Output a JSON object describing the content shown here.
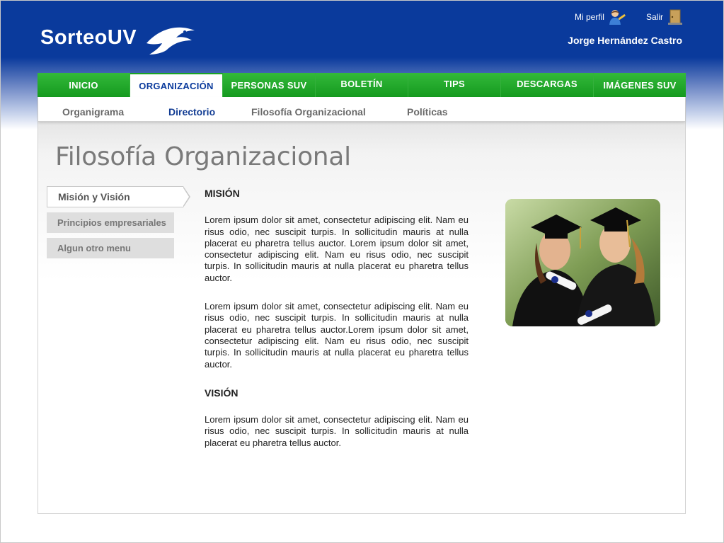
{
  "header": {
    "logo_text": "SorteoUV",
    "profile_label": "Mi perfil",
    "logout_label": "Salir",
    "user_name": "Jorge Hernández Castro"
  },
  "nav": {
    "items": [
      {
        "label": "INICIO"
      },
      {
        "label": "ORGANIZACIÓN"
      },
      {
        "label": "PERSONAS SUV"
      },
      {
        "label": "BOLETÍN"
      },
      {
        "label": "TIPS"
      },
      {
        "label": "DESCARGAS"
      },
      {
        "label": "IMÁGENES SUV"
      }
    ],
    "active": "ORGANIZACIÓN"
  },
  "subnav": {
    "items": [
      {
        "label": "Organigrama"
      },
      {
        "label": "Directorio"
      },
      {
        "label": "Filosofía Organizacional"
      },
      {
        "label": "Políticas"
      }
    ],
    "active": "Directorio"
  },
  "page": {
    "title": "Filosofía Organizacional"
  },
  "sidemenu": {
    "items": [
      {
        "label": "Misión y Visión"
      },
      {
        "label": "Principios empresariales"
      },
      {
        "label": "Algun otro menu"
      }
    ],
    "active": "Misión y Visión"
  },
  "article": {
    "mission_heading": "MISIÓN",
    "mission_p1": "Lorem ipsum dolor sit amet, consectetur adipiscing elit. Nam eu risus odio, nec suscipit turpis. In sollicitudin mauris at nulla placerat eu pharetra tellus auctor. Lorem ipsum dolor sit amet, consectetur adipiscing elit. Nam eu risus odio, nec suscipit turpis. In sollicitudin mauris at nulla placerat eu pharetra tellus auctor.",
    "mission_p2": "Lorem ipsum dolor sit amet, consectetur adipiscing elit. Nam eu risus odio, nec suscipit turpis. In sollicitudin mauris at nulla placerat eu pharetra tellus auctor.Lorem ipsum dolor sit amet, consectetur adipiscing elit. Nam eu risus odio, nec suscipit turpis. In sollicitudin mauris at nulla placerat eu pharetra tellus auctor.",
    "vision_heading": "VISIÓN",
    "vision_p1": "Lorem ipsum dolor sit amet, consectetur adipiscing elit. Nam eu risus odio, nec suscipit turpis. In sollicitudin mauris at nulla placerat eu pharetra tellus auctor."
  },
  "colors": {
    "header_blue": "#0a3a9c",
    "nav_green": "#1aa524",
    "active_blue": "#123c93"
  }
}
